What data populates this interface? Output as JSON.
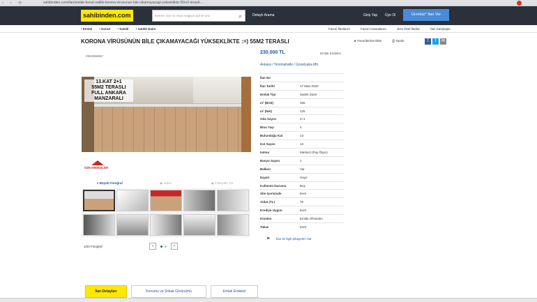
{
  "browser": {
    "url": "sahibinden.com/ilan/emlak-konut-satilik-korona-virusunun-bile-cikamayacagi-yukseklikte-55m2-terasli-..."
  },
  "header": {
    "logo": "sahibinden.com",
    "search_placeholder": "Kelime, ilan no veya mağaza adı ile ara",
    "advanced_search": "Detaylı Arama",
    "login": "Giriş Yap",
    "signup": "Üye Ol",
    "free_ad": "Ücretsiz* İlan Ver"
  },
  "breadcrumbs": [
    "Emlak",
    "Konut",
    "Satılık",
    "Satılık Daire"
  ],
  "top_links": [
    "Favori İlanlarım",
    "Favori Aramalarım",
    "Size Özel İlanlar",
    "İlan Karşılaştır"
  ],
  "listing": {
    "title": "KORONA VİRÜSÜNÜN BİLE ÇIKAMAYACAĞI YÜKSEKLİKTE :=) 55M2 TERASLI",
    "ad_code": "#902968957",
    "favorite": "Favorilerime Ekle",
    "print": "Yazdır",
    "price": "230.000 TL",
    "emlak_endeksi": "Emlak Endeksi",
    "location": [
      "Ankara",
      "Yenimahalle",
      "Gözelyaka Mh."
    ],
    "banner_text": "13.KAT 2+1\n55M2 TERASLI\nFULL ANKARA\nMANZARALI",
    "agency_name": "ÖZKARDEŞLER",
    "complaint": "İlan ile İlgili Şikayetim Var"
  },
  "photo_tabs": [
    "Büyük Fotoğraf",
    "Video",
    "3 Boyutlu Tur"
  ],
  "gallery": {
    "counter": "1/20 Fotoğraf",
    "prev": "‹",
    "next": "›"
  },
  "details": [
    {
      "k": "İlan No",
      "v": ""
    },
    {
      "k": "İlan Tarihi",
      "v": "17 Mart 2020"
    },
    {
      "k": "Emlak Tipi",
      "v": "Satılık Daire"
    },
    {
      "k": "m² (Brüt)",
      "v": "165"
    },
    {
      "k": "m² (Net)",
      "v": "125"
    },
    {
      "k": "Oda Sayısı",
      "v": "2+1"
    },
    {
      "k": "Bina Yaşı",
      "v": "4"
    },
    {
      "k": "Bulunduğu Kat",
      "v": "13"
    },
    {
      "k": "Kat Sayısı",
      "v": "13"
    },
    {
      "k": "Isıtma",
      "v": "Merkezi (Pay Ölçer)"
    },
    {
      "k": "Banyo Sayısı",
      "v": "1"
    },
    {
      "k": "Balkon",
      "v": "Var"
    },
    {
      "k": "Eşyalı",
      "v": "Hayır"
    },
    {
      "k": "Kullanım Durumu",
      "v": "Boş"
    },
    {
      "k": "Site İçerisinde",
      "v": "Evet"
    },
    {
      "k": "Aidat (TL)",
      "v": "75"
    },
    {
      "k": "Krediye Uygun",
      "v": "Evet"
    },
    {
      "k": "Kimden",
      "v": "Emlak Ofisinden"
    },
    {
      "k": "Takas",
      "v": "Evet"
    }
  ],
  "bottom_tabs": [
    "İlan Detayları",
    "Konumu ve Sokak Görünümü",
    "Emlak Endeksi"
  ]
}
